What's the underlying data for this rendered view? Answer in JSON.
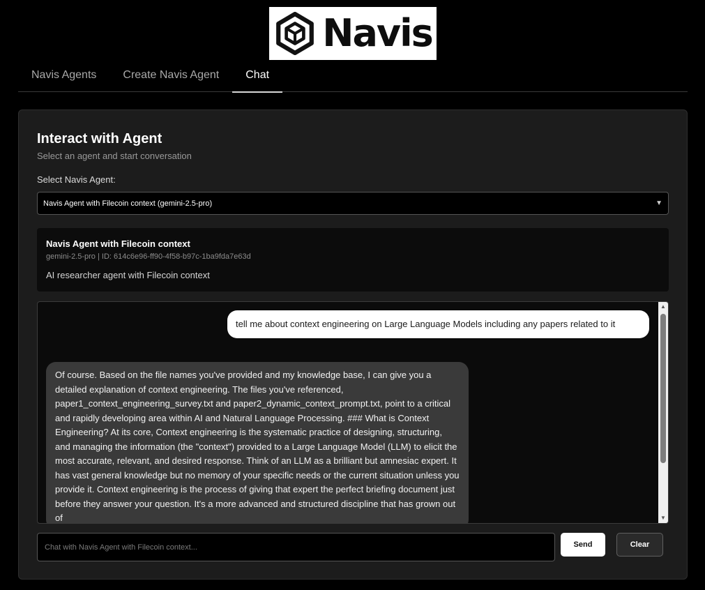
{
  "logo": {
    "text": "Navis",
    "icon": "hexagon-cube-logo-icon"
  },
  "tabs": [
    {
      "label": "Navis Agents",
      "active": false
    },
    {
      "label": "Create Navis Agent",
      "active": false
    },
    {
      "label": "Chat",
      "active": true
    }
  ],
  "panel": {
    "title": "Interact with Agent",
    "subtitle": "Select an agent and start conversation",
    "select_label": "Select Navis Agent:",
    "selected_agent": "Navis Agent with Filecoin context (gemini-2.5-pro)"
  },
  "agent": {
    "name": "Navis Agent with Filecoin context",
    "meta": "gemini-2.5-pro | ID: 614c6e96-ff90-4f58-b97c-1ba9fda7e63d",
    "description": "AI researcher agent with Filecoin context"
  },
  "chat": {
    "messages": [
      {
        "role": "user",
        "text": "tell me about context engineering on Large Language Models including any papers related to it"
      },
      {
        "role": "agent",
        "text": "Of course. Based on the file names you've provided and my knowledge base, I can give you a detailed explanation of context engineering. The files you've referenced, paper1_context_engineering_survey.txt and paper2_dynamic_context_prompt.txt, point to a critical and rapidly developing area within AI and Natural Language Processing. ### What is Context Engineering? At its core, Context engineering is the systematic practice of designing, structuring, and managing the information (the \"context\") provided to a Large Language Model (LLM) to elicit the most accurate, relevant, and desired response. Think of an LLM as a brilliant but amnesiac expert. It has vast general knowledge but no memory of your specific needs or the current situation unless you provide it. Context engineering is the process of giving that expert the perfect briefing document just before they answer your question. It's a more advanced and structured discipline that has grown out of"
      }
    ],
    "input_placeholder": "Chat with Navis Agent with Filecoin context...",
    "send_label": "Send",
    "clear_label": "Clear"
  }
}
